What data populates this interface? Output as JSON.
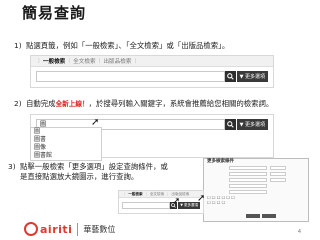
{
  "title": "簡易查詢",
  "steps": [
    {
      "num": "1)",
      "text": "點選頁籤，例如「一般檢索」、「全文檢索」或「出版品檢索」。"
    },
    {
      "num": "2)",
      "pre": "自動完成",
      "highlight": "全新上線！",
      "post": "，於搜尋列輸入關鍵字，系統會推薦給您相關的檢索詞。"
    },
    {
      "num": "3)",
      "line1": "點擊一般檢索「更多選項」設定查詢條件，或",
      "line2": "是直接點選放大鏡圖示，進行查詢。"
    }
  ],
  "widget1": {
    "tabs": [
      "一般檢索",
      "全文檢索",
      "出版品檢索"
    ],
    "search_value": "",
    "more_label": "▼ 更多選項"
  },
  "widget2": {
    "search_value": "圖",
    "more_label": "▼ 更多選項",
    "suggestions": [
      "圖",
      "圖書",
      "圖像",
      "圖書館"
    ]
  },
  "widget3": {
    "tabs": [
      "一般檢索",
      "全文檢索",
      "出版品檢索"
    ],
    "search_value": "",
    "more_label": "▼ 更多選項"
  },
  "advanced": {
    "header": "更多檢索條件"
  },
  "footer": {
    "logo": "airiti",
    "company": "華藝數位",
    "page": "4"
  },
  "colors": {
    "accent": "#dc3b2f",
    "highlight": "#e02020",
    "button": "#2e2e2e"
  }
}
